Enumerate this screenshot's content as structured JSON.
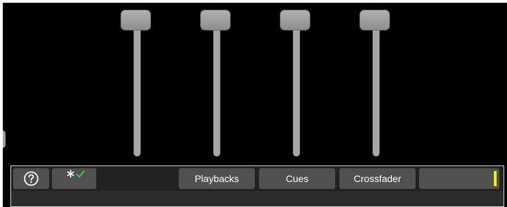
{
  "faders": [
    {
      "name": "fader-1",
      "level": 1.0
    },
    {
      "name": "fader-2",
      "level": 1.0
    },
    {
      "name": "fader-3",
      "level": 1.0
    },
    {
      "name": "fader-4",
      "level": 1.0
    }
  ],
  "toolbar": {
    "help_icon": "question-circle-icon",
    "status_icons": [
      "asterisk-icon",
      "checkmark-icon"
    ],
    "tabs": [
      {
        "label": "Playbacks"
      },
      {
        "label": "Cues"
      },
      {
        "label": "Crossfader"
      },
      {
        "label": ""
      }
    ]
  },
  "colors": {
    "background": "#000000",
    "button": "#505050",
    "fader": "#a6a6a6",
    "indicator": "#f4f000",
    "check": "#33c24a"
  }
}
